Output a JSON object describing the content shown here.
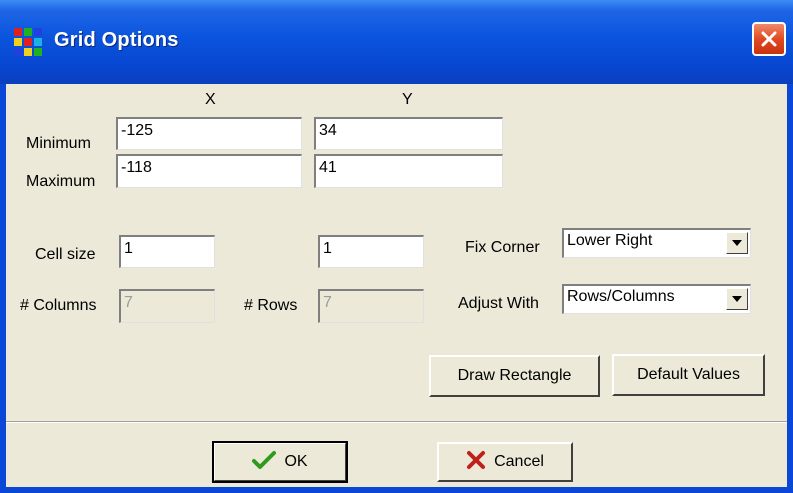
{
  "window": {
    "title": "Grid Options",
    "close_icon": "close-icon",
    "app_icon": "grid-icon"
  },
  "headers": {
    "x": "X",
    "y": "Y"
  },
  "extent": {
    "minimum_label": "Minimum",
    "maximum_label": "Maximum",
    "min_x": "-125",
    "min_y": "34",
    "max_x": "-118",
    "max_y": "41"
  },
  "cells": {
    "cell_size_label": "Cell size",
    "cell_size_x": "1",
    "cell_size_y": "1",
    "columns_label": "# Columns",
    "columns_value": "7",
    "rows_label": "# Rows",
    "rows_value": "7"
  },
  "options": {
    "fix_corner_label": "Fix Corner",
    "fix_corner_value": "Lower Right",
    "adjust_with_label": "Adjust With",
    "adjust_with_value": "Rows/Columns"
  },
  "buttons": {
    "draw_rectangle": "Draw Rectangle",
    "default_values": "Default Values",
    "ok": "OK",
    "cancel": "Cancel"
  },
  "colors": {
    "title_bar": "#0a54dd",
    "dialog_bg": "#ece9d8",
    "ok_check": "#2f9a1e",
    "cancel_x": "#c0201a"
  }
}
